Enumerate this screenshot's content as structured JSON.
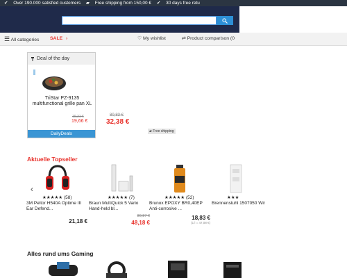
{
  "topbar": {
    "items": [
      "Over 190.000 satisfied customers",
      "Free shipping from 150,00 €",
      "30 days free retu"
    ]
  },
  "nav": {
    "all_categories": "All categories",
    "sale": "SALE",
    "wishlist": "My wishlist",
    "compare": "Product comparison (0"
  },
  "deal": {
    "header": "Deal of the day",
    "title": "TriStar PZ-9135 multifunctional grille pan XL",
    "old_price": "19,31 €",
    "price": "19,66 €",
    "button": "DailyDeals"
  },
  "second_deal": {
    "old_price": "80,83 €",
    "price": "32,38 €",
    "free_shipping": "Free shipping"
  },
  "topseller": {
    "title": "Aktuelle Topseller",
    "products": [
      {
        "rating": "★★★★★",
        "reviews": "(58)",
        "name": "3M Peltor H540A Optime III Ear Defend...",
        "old_price": "",
        "price": "21,18 €",
        "unit": ""
      },
      {
        "rating": "★★★★★",
        "reviews": "(7)",
        "name": "Braun MultiQuick 5 Vario Hand-held bl...",
        "old_price": "80,87 €",
        "price": "48,18 €",
        "unit": ""
      },
      {
        "rating": "★★★★★",
        "reviews": "(52)",
        "name": "Brunox EPOXY BR0,40EP Anti-corrosive ...",
        "old_price": "",
        "price": "18,83 €",
        "unit": "(1 l = 47,08 €)"
      },
      {
        "rating": "★★★",
        "reviews": "",
        "name": "Brennenstuhl 1507050 Wir",
        "old_price": "",
        "price": "",
        "unit": ""
      }
    ]
  },
  "gaming": {
    "title": "Alles rund ums Gaming"
  },
  "colors": {
    "topbar": "#2b3542",
    "header": "#1f2a4a",
    "accent": "#3a95d4",
    "sale": "#e8312b"
  }
}
